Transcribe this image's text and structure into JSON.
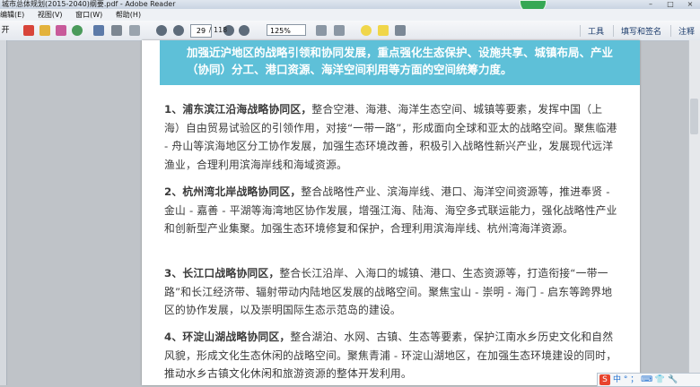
{
  "window": {
    "title": "城市总体规划(2015-2040)纲要.pdf - Adobe Reader",
    "badge": "",
    "buttons": [
      "–",
      "□",
      "×"
    ]
  },
  "menu": [
    "编辑(E)",
    "视图(V)",
    "窗口(W)",
    "帮助(H)"
  ],
  "toolbar": {
    "left_char": "开",
    "page_current": "29",
    "page_total": "/ 118",
    "zoom": "125%",
    "links": [
      "工具",
      "填写和签名",
      "注释"
    ]
  },
  "document": {
    "banner": "加强近沪地区的战略引领和协同发展，重点强化生态保护、设施共享、城镇布局、产业（协同）分工、港口资源、海洋空间利用等方面的空间统筹力度。",
    "sections": [
      {
        "heading": "1、浦东滨江沿海战略协同区，",
        "body": "整合空港、海港、海洋生态空间、城镇等要素，发挥中国（上海）自由贸易试验区的引领作用，对接“一带一路”，形成面向全球和亚太的战略空间。聚焦临港 - 舟山等滨海地区分工协作发展，加强生态环境改善，积极引入战略性新兴产业，发展现代远洋渔业，合理利用滨海岸线和海域资源。"
      },
      {
        "heading": "2、杭州湾北岸战略协同区，",
        "body": "整合战略性产业、滨海岸线、港口、海洋空间资源等，推进奉贤 - 金山 - 嘉善 - 平湖等海湾地区协作发展，增强江海、陆海、海空多式联运能力，强化战略性产业和创新型产业集聚。加强生态环境修复和保护，合理利用滨海岸线、杭州湾海洋资源。"
      },
      {
        "heading": "3、长江口战略协同区，",
        "body": "整合长江沿岸、入海口的城镇、港口、生态资源等，打造衔接“一带一路”和长江经济带、辐射带动内陆地区发展的战略空间。聚焦宝山 - 崇明 - 海门 - 启东等跨界地区的协作发展，以及崇明国际生态示范岛的建设。"
      },
      {
        "heading": "4、环淀山湖战略协同区，",
        "body": "整合湖泊、水网、古镇、生态等要素，保护江南水乡历史文化和自然风貌，形成文化生态休闲的战略空间。聚焦青浦 - 环淀山湖地区，在加强生态环境建设的同时，推动水乡古镇文化休闲和旅游资源的整体开发利用。"
      }
    ]
  },
  "ime": {
    "logo": "S",
    "text": "中 ° ；  ⌨ 👕 🔧"
  },
  "colors": {
    "banner": "#5ec0d8",
    "badge": "#36a854",
    "page_bg": "#ffffff",
    "workspace": "#bfc3c8"
  }
}
